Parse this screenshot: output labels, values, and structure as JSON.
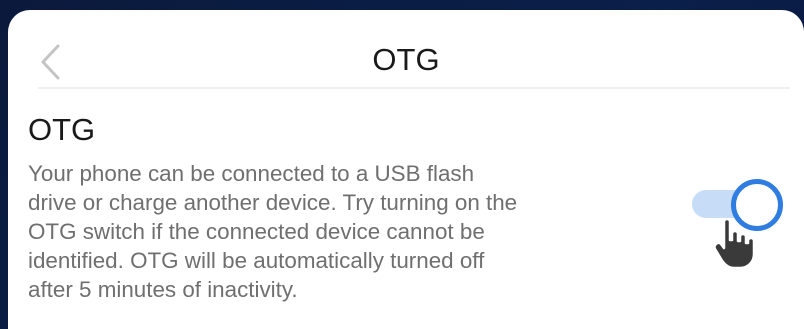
{
  "header": {
    "title": "OTG",
    "back_icon": "chevron-left-icon"
  },
  "section": {
    "title": "OTG",
    "description": "Your phone can be connected to a USB flash\ndrive or charge another device. Try turning on the\nOTG switch if the connected device cannot be\nidentified. OTG will be automatically turned off\nafter 5 minutes of inactivity."
  },
  "toggle": {
    "state": "on",
    "accent_color": "#2f7de1",
    "track_color": "#c6dcf7"
  },
  "overlay": {
    "pointer_icon": "hand-pointer-icon"
  }
}
